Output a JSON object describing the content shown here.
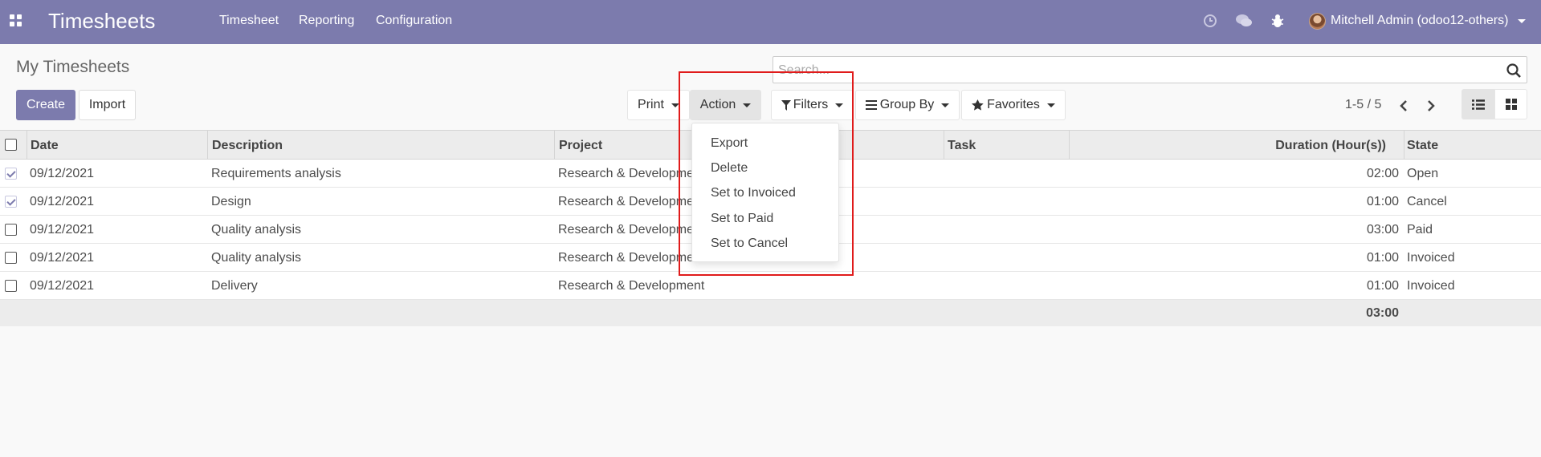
{
  "navbar": {
    "brand": "Timesheets",
    "menu": [
      "Timesheet",
      "Reporting",
      "Configuration"
    ],
    "icons": [
      "clock-icon",
      "chat-icon",
      "bug-icon"
    ],
    "user": "Mitchell Admin (odoo12-others)",
    "color": "#7c7bad"
  },
  "control": {
    "title": "My Timesheets",
    "create": "Create",
    "import": "Import",
    "print": "Print",
    "action": "Action",
    "filters": "Filters",
    "group_by": "Group By",
    "favorites": "Favorites",
    "search_placeholder": "Search...",
    "pager": "1-5 / 5"
  },
  "action_menu": [
    "Export",
    "Delete",
    "Set to Invoiced",
    "Set to Paid",
    "Set to Cancel"
  ],
  "table": {
    "headers": [
      "Date",
      "Description",
      "Project",
      "Task",
      "Duration (Hour(s))",
      "State"
    ],
    "rows": [
      {
        "checked": true,
        "date": "09/12/2021",
        "description": "Requirements analysis",
        "project": "Research & Developme",
        "duration": "02:00",
        "state": "Open"
      },
      {
        "checked": true,
        "date": "09/12/2021",
        "description": "Design",
        "project": "Research & Developme",
        "duration": "01:00",
        "state": "Cancel"
      },
      {
        "checked": false,
        "date": "09/12/2021",
        "description": "Quality analysis",
        "project": "Research & Developme",
        "duration": "03:00",
        "state": "Paid"
      },
      {
        "checked": false,
        "date": "09/12/2021",
        "description": "Quality analysis",
        "project": "Research & Developme",
        "duration": "01:00",
        "state": "Invoiced"
      },
      {
        "checked": false,
        "date": "09/12/2021",
        "description": "Delivery",
        "project": "Research & Development",
        "duration": "01:00",
        "state": "Invoiced"
      }
    ],
    "total": "03:00"
  }
}
